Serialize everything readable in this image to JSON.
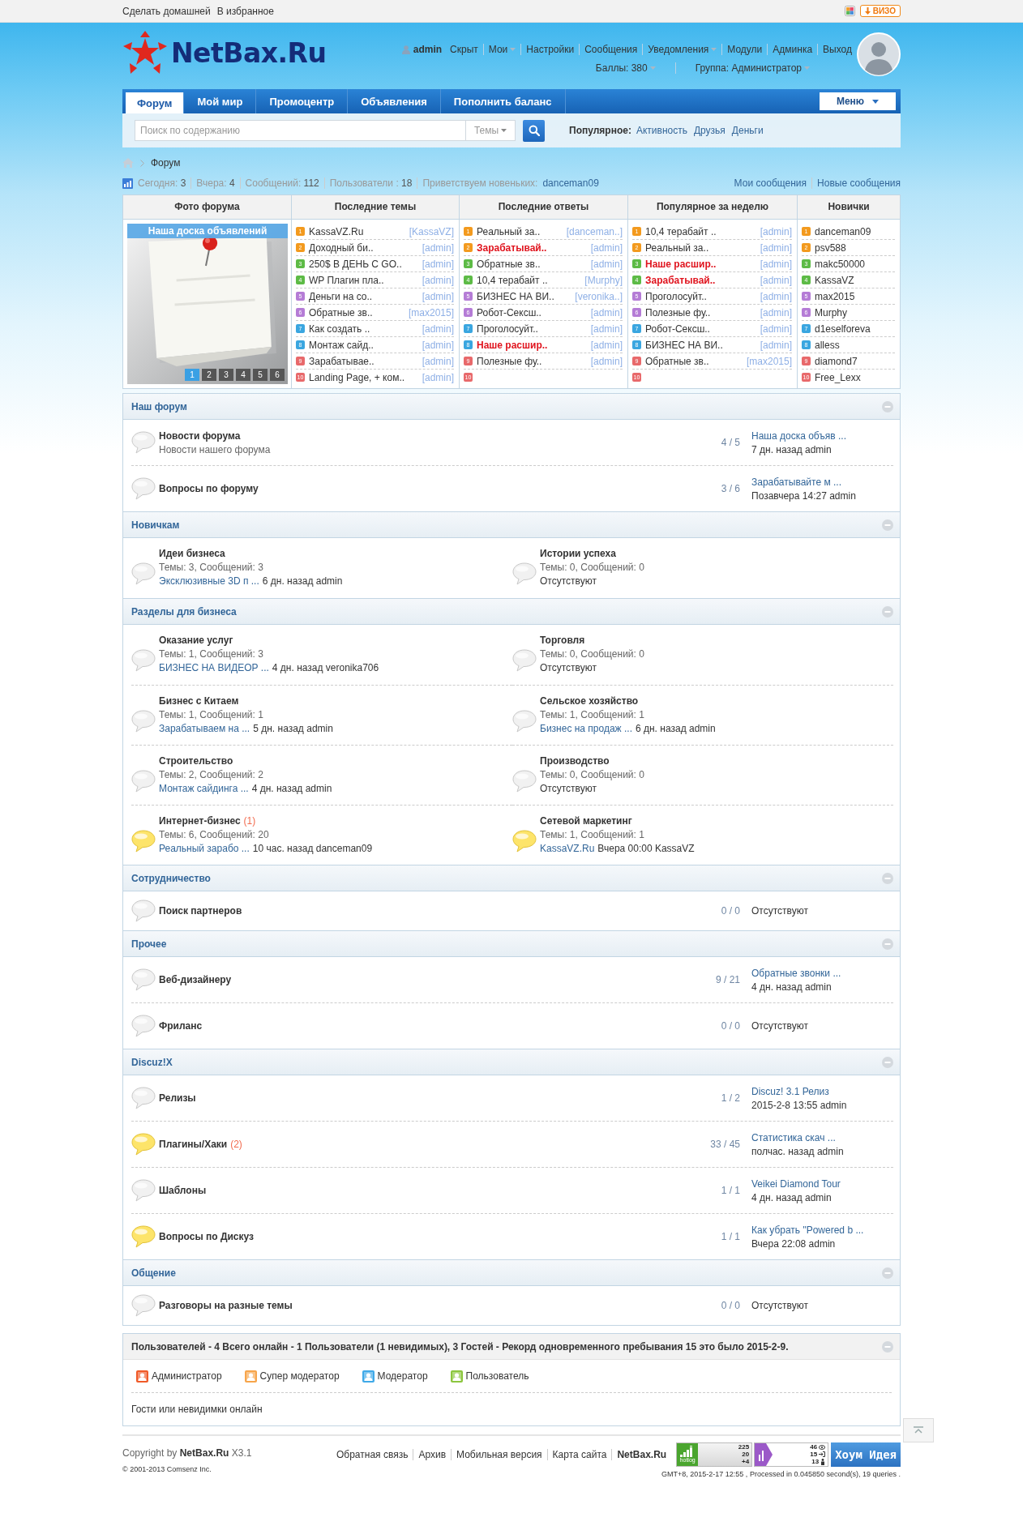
{
  "topbar": {
    "links": [
      "Сделать домашней",
      "В избранное"
    ],
    "badge": "ВИЗО"
  },
  "header": {
    "logo": "NetBax.Ru",
    "user": "admin",
    "links": [
      {
        "label": "Скрыт",
        "dropdown": false
      },
      {
        "label": "Мои",
        "dropdown": true
      },
      {
        "label": "Настройки",
        "dropdown": false
      },
      {
        "label": "Сообщения",
        "dropdown": false
      },
      {
        "label": "Уведомления",
        "dropdown": true
      },
      {
        "label": "Модули",
        "dropdown": false
      },
      {
        "label": "Админка",
        "dropdown": false
      },
      {
        "label": "Выход",
        "dropdown": false
      }
    ],
    "meta": [
      {
        "label": "Баллы: 380",
        "dropdown": true
      },
      {
        "label": "Группа: Администратор",
        "dropdown": true
      }
    ]
  },
  "nav": {
    "tabs": [
      {
        "label": "Форум",
        "selected": true
      },
      {
        "label": "Мой мир",
        "selected": false
      },
      {
        "label": "Промоцентр",
        "selected": false
      },
      {
        "label": "Объявления",
        "selected": false
      },
      {
        "label": "Пополнить баланс",
        "selected": false
      }
    ],
    "menu": "Меню"
  },
  "search": {
    "placeholder": "Поиск по содержанию",
    "scope": "Темы",
    "popular_label": "Популярное:",
    "popular": [
      "Активность",
      "Друзья",
      "Деньги"
    ]
  },
  "breadcrumb": [
    "Форум"
  ],
  "stats": {
    "items": [
      {
        "label": "Сегодня:",
        "value": "3"
      },
      {
        "label": "Вчера:",
        "value": "4"
      },
      {
        "label": "Сообщений:",
        "value": "112"
      },
      {
        "label": "Пользователи :",
        "value": "18"
      }
    ],
    "welcome": "Приветствуем новеньких:",
    "newest": "danceman09",
    "links": [
      "Мои сообщения",
      "Новые сообщения"
    ]
  },
  "table": {
    "columns": [
      {
        "heading": "Фото форума",
        "caption": "Наша доска объявлений",
        "slides": [
          {
            "label": "1",
            "selected": true
          },
          {
            "label": "2",
            "selected": false
          },
          {
            "label": "3",
            "selected": false
          },
          {
            "label": "4",
            "selected": false
          },
          {
            "label": "5",
            "selected": false
          },
          {
            "label": "6",
            "selected": false
          }
        ]
      },
      {
        "kind": "threads",
        "heading": "Последние темы",
        "items": [
          {
            "rank": "1",
            "title": "KassaVZ.Ru",
            "author": "[KassaVZ]",
            "hot": false
          },
          {
            "rank": "2",
            "title": "Доходный би..",
            "author": "[admin]",
            "hot": false
          },
          {
            "rank": "3",
            "title": "250$ В ДЕНЬ С GO..",
            "author": "[admin]",
            "hot": false
          },
          {
            "rank": "4",
            "title": "WP Плагин пла..",
            "author": "[admin]",
            "hot": false
          },
          {
            "rank": "5",
            "title": "Деньги на со..",
            "author": "[admin]",
            "hot": false
          },
          {
            "rank": "6",
            "title": "Обратные зв..",
            "author": "[max2015]",
            "hot": false
          },
          {
            "rank": "7",
            "title": "Как создать ..",
            "author": "[admin]",
            "hot": false
          },
          {
            "rank": "8",
            "title": "Монтаж сайд..",
            "author": "[admin]",
            "hot": false
          },
          {
            "rank": "9",
            "title": "Зарабатывае..",
            "author": "[admin]",
            "hot": false
          },
          {
            "rank": "10",
            "title": "Landing Page, + ком..",
            "author": "[admin]",
            "hot": false
          }
        ]
      },
      {
        "kind": "threads",
        "heading": "Последние ответы",
        "items": [
          {
            "rank": "1",
            "title": "Реальный за..",
            "author": "[danceman..]",
            "hot": false
          },
          {
            "rank": "2",
            "title": "Зарабатывай..",
            "author": "[admin]",
            "hot": true
          },
          {
            "rank": "3",
            "title": "Обратные зв..",
            "author": "[admin]",
            "hot": false
          },
          {
            "rank": "4",
            "title": "10,4 терабайт ..",
            "author": "[Murphy]",
            "hot": false
          },
          {
            "rank": "5",
            "title": "БИЗНЕС НА ВИ..",
            "author": "[veronika..]",
            "hot": false
          },
          {
            "rank": "6",
            "title": "Робот-Сексш..",
            "author": "[admin]",
            "hot": false
          },
          {
            "rank": "7",
            "title": "Проголосуйт..",
            "author": "[admin]",
            "hot": false
          },
          {
            "rank": "8",
            "title": "Наше расшир..",
            "author": "[admin]",
            "hot": true
          },
          {
            "rank": "9",
            "title": "Полезные фу..",
            "author": "[admin]",
            "hot": false
          },
          {
            "rank": "10"
          }
        ]
      },
      {
        "kind": "threads",
        "heading": "Популярное за неделю",
        "items": [
          {
            "rank": "1",
            "title": "10,4 терабайт ..",
            "author": "[admin]",
            "hot": false
          },
          {
            "rank": "2",
            "title": "Реальный за..",
            "author": "[admin]",
            "hot": false
          },
          {
            "rank": "3",
            "title": "Наше расшир..",
            "author": "[admin]",
            "hot": true
          },
          {
            "rank": "4",
            "title": "Зарабатывай..",
            "author": "[admin]",
            "hot": true
          },
          {
            "rank": "5",
            "title": "Проголосуйт..",
            "author": "[admin]",
            "hot": false
          },
          {
            "rank": "6",
            "title": "Полезные фу..",
            "author": "[admin]",
            "hot": false
          },
          {
            "rank": "7",
            "title": "Робот-Сексш..",
            "author": "[admin]",
            "hot": false
          },
          {
            "rank": "8",
            "title": "БИЗНЕС НА ВИ..",
            "author": "[admin]",
            "hot": false
          },
          {
            "rank": "9",
            "title": "Обратные зв..",
            "author": "[max2015]",
            "hot": false
          },
          {
            "rank": "10"
          }
        ]
      },
      {
        "kind": "users",
        "heading": "Новички",
        "items": [
          {
            "rank": "1",
            "title": "danceman09"
          },
          {
            "rank": "2",
            "title": "psv588"
          },
          {
            "rank": "3",
            "title": "makc50000"
          },
          {
            "rank": "4",
            "title": "KassaVZ"
          },
          {
            "rank": "5",
            "title": "max2015"
          },
          {
            "rank": "6",
            "title": "Murphy"
          },
          {
            "rank": "7",
            "title": "d1eselforeva"
          },
          {
            "rank": "8",
            "title": "alless"
          },
          {
            "rank": "9",
            "title": "diamond7"
          },
          {
            "rank": "10",
            "title": "Free_Lexx"
          }
        ]
      }
    ]
  },
  "categories": [
    {
      "title": "Наш форум",
      "kind": "list",
      "forums": [
        {
          "name": "Новости форума",
          "new": false,
          "desc": "Новости нашего форума",
          "count": "4 / 5",
          "last_title": "Наша доска объяв ...",
          "last_meta": "7 дн. назад admin"
        },
        {
          "name": "Вопросы по форуму",
          "new": false,
          "count": "3 / 6",
          "last_title": "Зарабатывайте м ...",
          "last_meta": "Позавчера 14:27 admin"
        }
      ]
    },
    {
      "title": "Новичкам",
      "kind": "grid",
      "forums": [
        {
          "name": "Идеи бизнеса",
          "new": false,
          "stats": "Темы: 3, Сообщений: 3",
          "last_title": "Эксклюзивные 3D п ...",
          "last_meta": "6 дн. назад admin"
        },
        {
          "name": "Истории успеха",
          "new": false,
          "stats": "Темы: 0, Сообщений: 0",
          "none": "Отсутствуют"
        }
      ]
    },
    {
      "title": "Разделы для бизнеса",
      "kind": "grid",
      "forums": [
        {
          "name": "Оказание услуг",
          "new": false,
          "stats": "Темы: 1, Сообщений: 3",
          "last_title": "БИЗНЕС НА ВИДЕОР ...",
          "last_meta": "4 дн. назад veronika706"
        },
        {
          "name": "Торговля",
          "new": false,
          "stats": "Темы: 0, Сообщений: 0",
          "none": "Отсутствуют"
        },
        {
          "name": "Бизнес с Китаем",
          "new": false,
          "stats": "Темы: 1, Сообщений: 1",
          "last_title": "Зарабатываем на ...",
          "last_meta": "5 дн. назад admin"
        },
        {
          "name": "Сельское хозяйство",
          "new": false,
          "stats": "Темы: 1, Сообщений: 1",
          "last_title": "Бизнес на продаж ...",
          "last_meta": "6 дн. назад admin"
        },
        {
          "name": "Строительство",
          "new": false,
          "stats": "Темы: 2, Сообщений: 2",
          "last_title": "Монтаж сайдинга ...",
          "last_meta": "4 дн. назад admin"
        },
        {
          "name": "Производство",
          "new": false,
          "stats": "Темы: 0, Сообщений: 0",
          "none": "Отсутствуют"
        },
        {
          "name": "Интернет-бизнес",
          "new": true,
          "new_count": "(1)",
          "stats": "Темы: 6, Сообщений: 20",
          "last_title": "Реальный зарабо ...",
          "last_meta": "10 час. назад danceman09"
        },
        {
          "name": "Сетевой маркетинг",
          "new": true,
          "stats": "Темы: 1, Сообщений: 1",
          "last_title": "KassaVZ.Ru",
          "last_meta": "Вчера 00:00 KassaVZ"
        }
      ]
    },
    {
      "title": "Сотрудничество",
      "kind": "list",
      "forums": [
        {
          "name": "Поиск партнеров",
          "new": false,
          "count": "0 / 0",
          "none": "Отсутствуют"
        }
      ]
    },
    {
      "title": "Прочее",
      "kind": "list",
      "forums": [
        {
          "name": "Веб-дизайнеру",
          "new": false,
          "count": "9 / 21",
          "last_title": "Обратные звонки ...",
          "last_meta": "4 дн. назад admin"
        },
        {
          "name": "Фриланс",
          "new": false,
          "count": "0 / 0",
          "none": "Отсутствуют"
        }
      ]
    },
    {
      "title": "Discuz!X",
      "kind": "list",
      "forums": [
        {
          "name": "Релизы",
          "new": false,
          "count": "1 / 2",
          "last_title": "Discuz! 3.1 Релиз",
          "last_meta": "2015-2-8 13:55 admin"
        },
        {
          "name": "Плагины/Хаки",
          "new": true,
          "new_count": "(2)",
          "count": "33 / 45",
          "last_title": "Статистика скач ...",
          "last_meta": "полчас. назад admin"
        },
        {
          "name": "Шаблоны",
          "new": false,
          "count": "1 / 1",
          "last_title": "Veikei Diamond Tour",
          "last_meta": "4 дн. назад admin"
        },
        {
          "name": "Вопросы по Дискуз",
          "new": true,
          "count": "1 / 1",
          "last_title": "Как убрать \"Powered b ...",
          "last_meta": "Вчера 22:08 admin"
        }
      ]
    },
    {
      "title": "Общение",
      "kind": "list",
      "forums": [
        {
          "name": "Разговоры на разные темы",
          "new": false,
          "count": "0 / 0",
          "none": "Отсутствуют"
        }
      ]
    }
  ],
  "online": {
    "title": "Пользователей - 4 Всего онлайн - 1 Пользователи (1 невидимых), 3 Гостей - Рекорд одновременного пребывания 15 это было 2015-2-9.",
    "legend": [
      {
        "label": "Администратор",
        "color": "#f05a28"
      },
      {
        "label": "Супер модератор",
        "color": "#f7a54a"
      },
      {
        "label": "Модератор",
        "color": "#3fa9e8"
      },
      {
        "label": "Пользователь",
        "color": "#8cc63e"
      }
    ],
    "guests": "Гости или невидимки онлайн"
  },
  "footer": {
    "copyright": "Copyright by **NetBax.Ru** X3.1",
    "comsenz": "© 2001-2013 Comsenz Inc.",
    "links": [
      "Обратная связь",
      "Архив",
      "Мобильная версия",
      "Карта сайта"
    ],
    "brand": "NetBax.Ru",
    "hotlog": {
      "label": "hotlog",
      "numbers": [
        "225",
        "20",
        "+4"
      ]
    },
    "liveinternet": {
      "numbers": [
        "46",
        "15",
        "13"
      ]
    },
    "banner": "Хоум Идея",
    "processed": "GMT+8, 2015-2-17 12:55 , Processed in 0.045850 second(s), 19 queries ."
  }
}
